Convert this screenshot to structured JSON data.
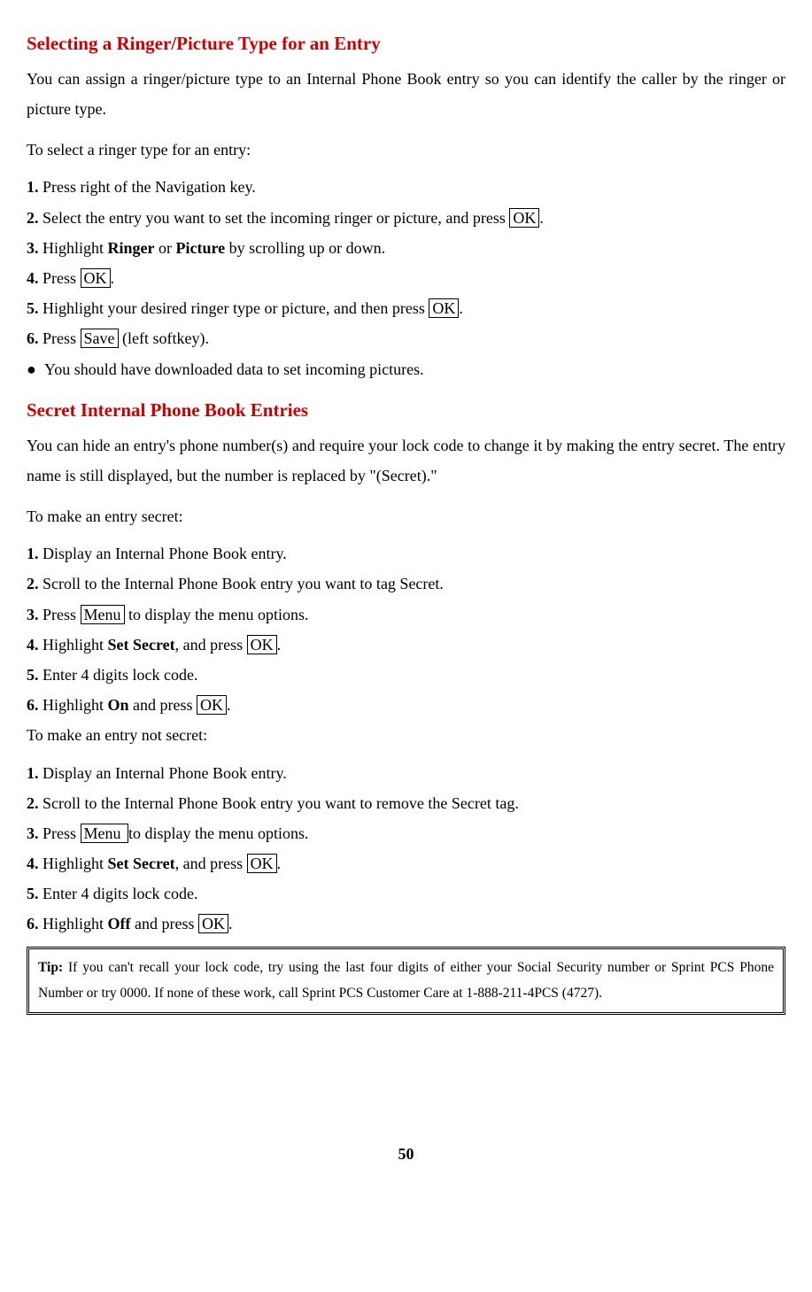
{
  "section1": {
    "heading": "Selecting a Ringer/Picture Type for an Entry",
    "para": "You can assign a ringer/picture type to an Internal Phone Book entry so you can identify the caller by the ringer or picture type.",
    "intro": "To select a ringer type for an entry:",
    "s1": {
      "n": "1.",
      "t": " Press right of the Navigation key."
    },
    "s2": {
      "n": "2.",
      "a": " Select the entry you want to set the incoming ringer or picture, and press ",
      "k": "OK",
      "b": "."
    },
    "s3": {
      "n": "3.",
      "a": " Highlight ",
      "opt1": "Ringer",
      "mid": " or ",
      "opt2": "Picture",
      "b": " by scrolling up or down."
    },
    "s4": {
      "n": "4.",
      "a": " Press ",
      "k": "OK",
      "b": "."
    },
    "s5": {
      "n": "5.",
      "a": " Highlight your desired ringer type or picture, and then press ",
      "k": "OK",
      "b": "."
    },
    "s6": {
      "n": "6.",
      "a": " Press ",
      "k": "Save",
      "b": " (left softkey)."
    },
    "bullet": {
      "dot": "●",
      "t": "You should have downloaded data to set incoming pictures."
    }
  },
  "section2": {
    "heading": "Secret Internal Phone Book Entries",
    "para": "You can hide an entry's phone number(s) and require your lock code to change it by making the entry secret. The entry name is still displayed, but the number is replaced by \"(Secret).\"",
    "introA": "To make an entry secret:",
    "A": {
      "s1": {
        "n": "1.",
        "t": " Display an Internal Phone Book entry."
      },
      "s2": {
        "n": "2.",
        "t": " Scroll to the Internal Phone Book entry you want to tag Secret."
      },
      "s3": {
        "n": "3.",
        "a": " Press ",
        "k": "Menu",
        "b": " to display the menu options."
      },
      "s4": {
        "n": "4.",
        "a": " Highlight ",
        "opt": "Set Secret",
        "mid": ", and press ",
        "k": "OK",
        "b": "."
      },
      "s5": {
        "n": "5.",
        "t": " Enter 4 digits lock code."
      },
      "s6": {
        "n": "6.",
        "a": " Highlight ",
        "opt": "On",
        "mid": " and press ",
        "k": "OK",
        "b": "."
      }
    },
    "introB": "To make an entry not secret:",
    "B": {
      "s1": {
        "n": "1.",
        "t": " Display an Internal Phone Book entry."
      },
      "s2": {
        "n": "2.",
        "t": " Scroll to the Internal Phone Book entry you want to remove the Secret tag."
      },
      "s3": {
        "n": "3.",
        "a": " Press ",
        "k": "Menu ",
        "b": "  to display the menu options."
      },
      "s4": {
        "n": "4.",
        "a": " Highlight ",
        "opt": "Set Secret",
        "mid": ", and press ",
        "k": "OK",
        "b": "."
      },
      "s5": {
        "n": "5.",
        "t": " Enter 4 digits lock code."
      },
      "s6": {
        "n": "6.",
        "a": " Highlight ",
        "opt": "Off",
        "mid": " and press ",
        "k": "OK",
        "b": "."
      }
    }
  },
  "tip": {
    "label": "Tip:",
    "text": " If you can't recall your lock code, try using the last four digits of either your Social Security number or Sprint PCS Phone Number or try 0000. If none of these work, call Sprint PCS Customer Care at 1-888-211-4PCS (4727)."
  },
  "page": "50"
}
